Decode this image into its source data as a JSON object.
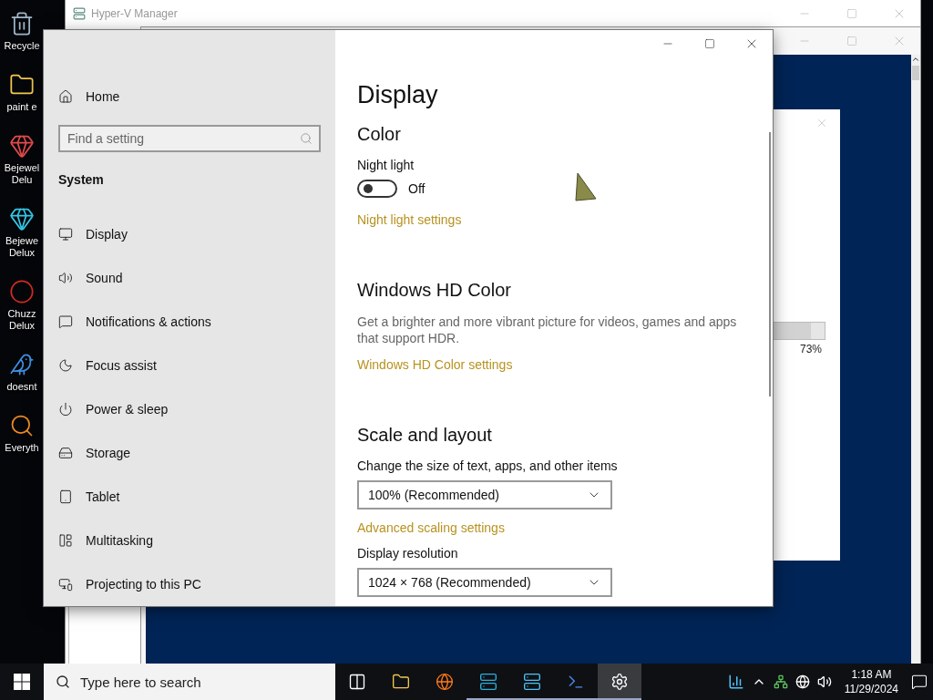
{
  "desktop_icons": [
    {
      "lines": [
        "Recycle"
      ]
    },
    {
      "lines": [
        "paint e"
      ]
    },
    {
      "lines": [
        "Bejewel",
        "Delu"
      ]
    },
    {
      "lines": [
        "Bejewe",
        "Delux"
      ]
    },
    {
      "lines": [
        "Chuzz",
        "Delux"
      ]
    },
    {
      "lines": [
        "doesnt"
      ]
    },
    {
      "lines": [
        "Everyth"
      ]
    }
  ],
  "hyperv": {
    "title": "Hyper-V Manager"
  },
  "vm_dialog": {
    "progress": {
      "level": 0.73,
      "reading": "73%"
    }
  },
  "settings": {
    "nav": {
      "home": "Home",
      "search_placeholder": "Find a setting",
      "section": "System",
      "items": [
        {
          "label": "Display"
        },
        {
          "label": "Sound"
        },
        {
          "label": "Notifications & actions"
        },
        {
          "label": "Focus assist"
        },
        {
          "label": "Power & sleep"
        },
        {
          "label": "Storage"
        },
        {
          "label": "Tablet"
        },
        {
          "label": "Multitasking"
        },
        {
          "label": "Projecting to this PC"
        }
      ]
    },
    "content": [
      {
        "kind": "title",
        "text": "Display"
      },
      {
        "kind": "heading",
        "text": "Color"
      },
      {
        "kind": "label",
        "text": "Night light"
      },
      {
        "kind": "toggle",
        "on": false,
        "text": "Off"
      },
      {
        "kind": "link",
        "text": "Night light settings"
      },
      {
        "kind": "heading",
        "text": "Windows HD Color"
      },
      {
        "kind": "description",
        "text": "Get a brighter and more vibrant picture for videos, games and apps that support HDR."
      },
      {
        "kind": "link",
        "text": "Windows HD Color settings"
      },
      {
        "kind": "heading",
        "text": "Scale and layout"
      },
      {
        "kind": "label",
        "text": "Change the size of text, apps, and other items"
      },
      {
        "kind": "dropdown",
        "value": "100% (Recommended)"
      },
      {
        "kind": "link",
        "text": "Advanced scaling settings"
      },
      {
        "kind": "label",
        "text": "Display resolution"
      },
      {
        "kind": "dropdown",
        "value": "1024 × 768 (Recommended)"
      }
    ]
  },
  "taskbar": {
    "search_placeholder": "Type here to search",
    "apps": [
      {
        "running": false,
        "active": false
      },
      {
        "running": false,
        "active": false
      },
      {
        "running": false,
        "active": false
      },
      {
        "running": true,
        "active": false
      },
      {
        "running": true,
        "active": false
      },
      {
        "running": true,
        "active": false
      },
      {
        "running": true,
        "active": true
      }
    ],
    "time": "1:18 AM",
    "date": "11/29/2024"
  }
}
